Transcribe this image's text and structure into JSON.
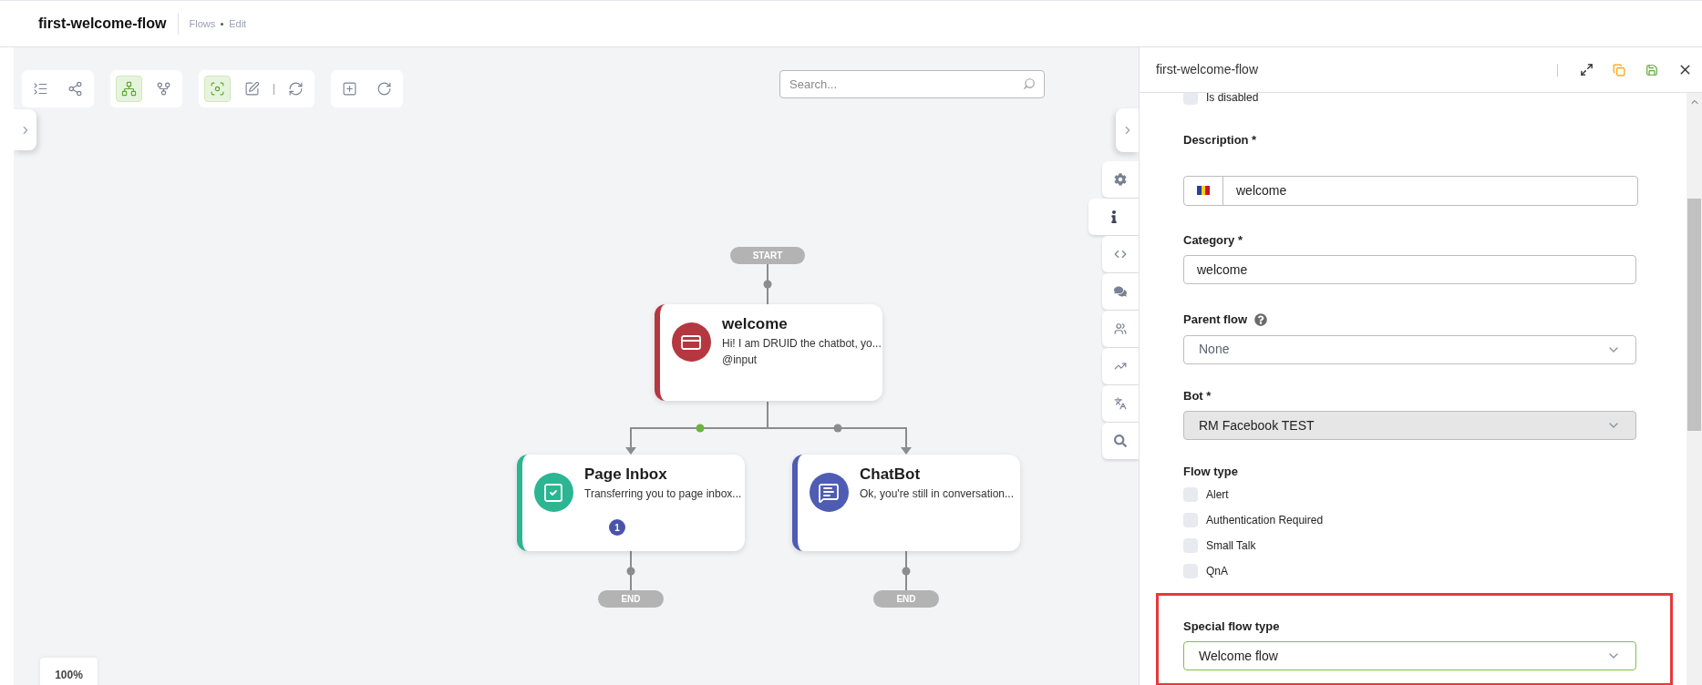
{
  "header": {
    "title": "first-welcome-flow",
    "breadcrumb": [
      "Flows",
      "Edit"
    ]
  },
  "toolbar": [
    {
      "sections": [
        [
          {
            "kind": "collapse",
            "selected": false
          },
          {
            "kind": "nodes",
            "selected": false
          }
        ]
      ]
    },
    {
      "sections": [
        [
          {
            "kind": "tree",
            "selected": true
          },
          {
            "kind": "fork",
            "selected": false
          }
        ]
      ]
    },
    {
      "sections": [
        [
          {
            "kind": "focus",
            "selected": true
          },
          {
            "kind": "edit",
            "selected": false
          }
        ],
        [
          {
            "kind": "refresh",
            "selected": false
          }
        ]
      ]
    },
    {
      "sections": [
        [
          {
            "kind": "add",
            "selected": false
          },
          {
            "kind": "rotate",
            "selected": false
          }
        ]
      ]
    }
  ],
  "search": {
    "placeholder": "Search..."
  },
  "flow": {
    "start": "START",
    "root": {
      "kind": "card",
      "title": "welcome",
      "lines": [
        "Hi! I am DRUID the chatbot, yo...",
        "@input"
      ],
      "color": "#b5373f"
    },
    "branches": [
      {
        "active": true
      },
      {
        "active": false
      }
    ],
    "children": [
      {
        "kind": "inbox",
        "title": "Page Inbox",
        "lines": [
          "Transferring you to page inbox..."
        ],
        "color": "#2bb592",
        "badge": "1",
        "end": "END"
      },
      {
        "kind": "chat",
        "title": "ChatBot",
        "lines": [
          "Ok, you're still in conversation..."
        ],
        "color": "#4f5cb3",
        "end": "END"
      }
    ]
  },
  "zoom": "100%",
  "side_tabs": [
    {
      "kind": "settings",
      "selected": false
    },
    {
      "kind": "info",
      "selected": true
    },
    {
      "kind": "code",
      "selected": false
    },
    {
      "kind": "chat",
      "selected": false
    },
    {
      "kind": "people",
      "selected": false
    },
    {
      "kind": "chart",
      "selected": false
    },
    {
      "kind": "translate",
      "selected": false
    },
    {
      "kind": "search",
      "selected": false
    }
  ],
  "panel": {
    "title": "first-welcome-flow",
    "fields": [
      {
        "kind": "checkbox",
        "label": "Is disabled",
        "checked": false
      },
      {
        "kind": "localized_text",
        "label": "Description *",
        "value": "welcome"
      },
      {
        "kind": "text",
        "label": "Category *",
        "value": "welcome"
      },
      {
        "kind": "select",
        "label": "Parent flow",
        "help": true,
        "value": "None",
        "disabled": false,
        "focused": false,
        "highlighted": false
      },
      {
        "kind": "select",
        "label": "Bot *",
        "help": false,
        "value": "RM Facebook TEST",
        "disabled": true,
        "focused": false,
        "highlighted": false
      },
      {
        "kind": "checkbox_group",
        "label": "Flow type",
        "options": [
          {
            "label": "Alert",
            "checked": false
          },
          {
            "label": "Authentication Required",
            "checked": false
          },
          {
            "label": "Small Talk",
            "checked": false
          },
          {
            "label": "QnA",
            "checked": false
          }
        ]
      },
      {
        "kind": "select",
        "label": "Special flow type",
        "help": false,
        "value": "Welcome flow",
        "disabled": false,
        "focused": true,
        "highlighted": true
      }
    ]
  }
}
